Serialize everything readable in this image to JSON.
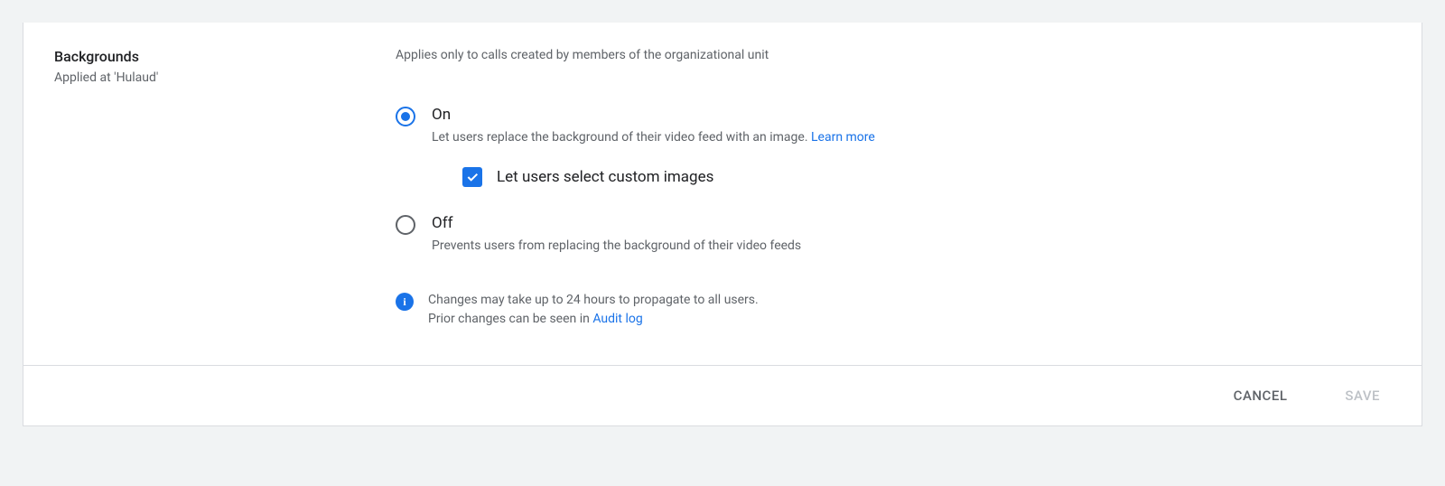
{
  "section": {
    "title": "Backgrounds",
    "appliedAt": "Applied at 'Hulaud'"
  },
  "scopeText": "Applies only to calls created by members of the organizational unit",
  "options": {
    "on": {
      "label": "On",
      "desc": "Let users replace the background of their video feed with an image. ",
      "learnMore": "Learn more"
    },
    "checkbox": {
      "label": "Let users select custom images"
    },
    "off": {
      "label": "Off",
      "desc": "Prevents users from replacing the background of their video feeds"
    }
  },
  "info": {
    "line1": "Changes may take up to 24 hours to propagate to all users.",
    "line2Prefix": "Prior changes can be seen in ",
    "auditLink": "Audit log"
  },
  "footer": {
    "cancel": "CANCEL",
    "save": "SAVE"
  }
}
